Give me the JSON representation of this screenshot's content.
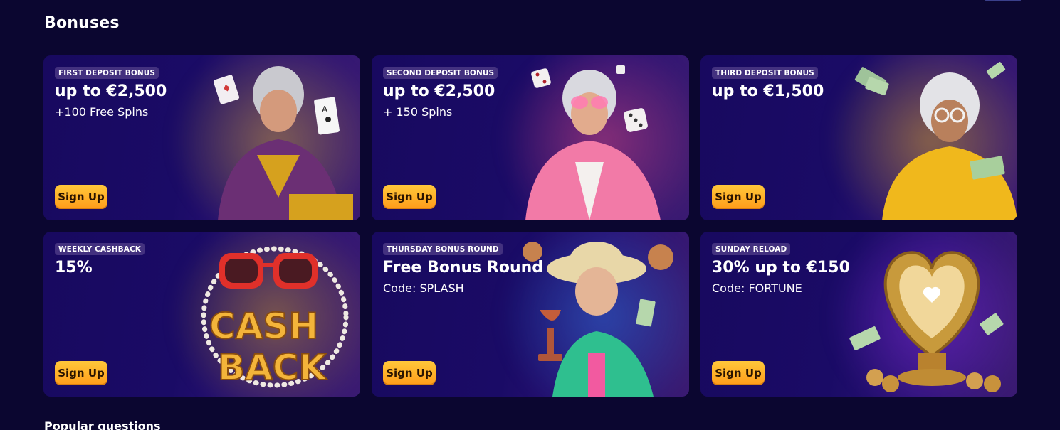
{
  "page": {
    "section_title": "Bonuses",
    "next_section_title": "Popular questions"
  },
  "colors": {
    "background": "#0b0630",
    "card": "#1a0b66",
    "badge": "#43317f",
    "cta_top": "#ffc83a",
    "cta_bottom": "#ff9c1a"
  },
  "cards": [
    {
      "badge": "FIRST DEPOSIT BONUS",
      "headline": "up to €2,500",
      "subline": "+100 Free Spins",
      "cta": "Sign Up",
      "art": "grandma-with-playing-cards-illustration",
      "glow": "#c59a3a"
    },
    {
      "badge": "SECOND DEPOSIT BONUS",
      "headline": "up to €2,500",
      "subline": "+ 150 Spins",
      "cta": "Sign Up",
      "art": "grandma-in-pink-fur-with-dice-illustration",
      "glow": "#d0457a"
    },
    {
      "badge": "THIRD DEPOSIT BONUS",
      "headline": "up to €1,500",
      "subline": "",
      "cta": "Sign Up",
      "art": "grandma-in-yellow-with-banknotes-illustration",
      "glow": "#c5962d"
    },
    {
      "badge": "WEEKLY CASHBACK",
      "headline": "15%",
      "subline": "",
      "cta": "Sign Up",
      "art": "cashback-sunglasses-pearls-illustration",
      "glow": "#b88a2e"
    },
    {
      "badge": "THURSDAY BONUS ROUND",
      "headline": "Free Bonus Round",
      "subline": "Code: SPLASH",
      "cta": "Sign Up",
      "art": "grandma-with-hat-and-trophy-illustration",
      "glow": "#2c63c8"
    },
    {
      "badge": "SUNDAY RELOAD",
      "headline": "30% up to €150",
      "subline": "Code: FORTUNE",
      "cta": "Sign Up",
      "art": "golden-heart-trophy-coins-illustration",
      "glow": "#7a2bd0"
    }
  ]
}
